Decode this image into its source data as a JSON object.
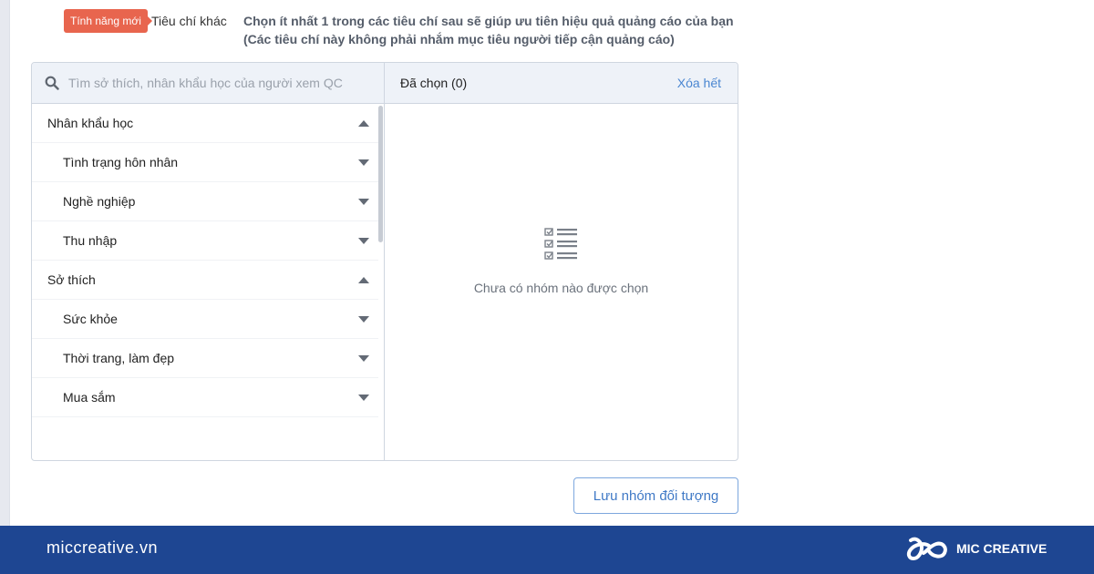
{
  "header": {
    "badge": "Tính năng mới",
    "criteria_label": "Tiêu chí khác",
    "description_line1": "Chọn ít nhất 1 trong các tiêu chí sau sẽ giúp ưu tiên hiệu quả quảng cáo của bạn",
    "description_line2": "(Các tiêu chí này không phải nhắm mục tiêu người tiếp cận quảng cáo)"
  },
  "search": {
    "placeholder": "Tìm sở thích, nhân khẩu học của người xem QC",
    "value": "",
    "icon": "search-icon"
  },
  "categories": [
    {
      "label": "Nhân khẩu học",
      "type": "group",
      "expanded": true
    },
    {
      "label": "Tình trạng hôn nhân",
      "type": "sub",
      "expanded": false
    },
    {
      "label": "Nghề nghiệp",
      "type": "sub",
      "expanded": false
    },
    {
      "label": "Thu nhập",
      "type": "sub",
      "expanded": false
    },
    {
      "label": "Sở thích",
      "type": "group",
      "expanded": true
    },
    {
      "label": "Sức khỏe",
      "type": "sub",
      "expanded": false
    },
    {
      "label": "Thời trang, làm đẹp",
      "type": "sub",
      "expanded": false
    },
    {
      "label": "Mua sắm",
      "type": "sub",
      "expanded": false
    }
  ],
  "selected": {
    "title": "Đã chọn (0)",
    "count": 0,
    "clear_label": "Xóa hết",
    "empty_text": "Chưa có nhóm nào được chọn",
    "empty_icon": "checklist-icon"
  },
  "actions": {
    "save_label": "Lưu nhóm đối tượng"
  },
  "footer": {
    "site": "miccreative.vn",
    "brand": "MIC CREATIVE"
  },
  "colors": {
    "badge": "#e8654e",
    "accent": "#4a86d1",
    "footer_bg": "#1e4692"
  }
}
